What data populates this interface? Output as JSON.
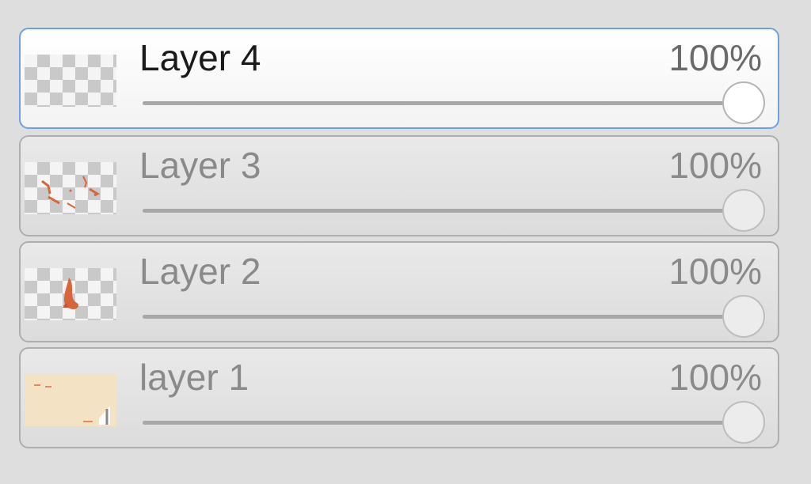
{
  "layers": [
    {
      "name": "Layer 4",
      "opacity_label": "100%",
      "opacity": 1.0,
      "active": true,
      "thumbnail_icon": "transparent-checker-thumbnail"
    },
    {
      "name": "Layer 3",
      "opacity_label": "100%",
      "opacity": 1.0,
      "active": false,
      "thumbnail_icon": "orange-strokes-thumbnail"
    },
    {
      "name": "Layer 2",
      "opacity_label": "100%",
      "opacity": 1.0,
      "active": false,
      "thumbnail_icon": "orange-figure-thumbnail"
    },
    {
      "name": "layer 1",
      "opacity_label": "100%",
      "opacity": 1.0,
      "active": false,
      "thumbnail_icon": "beige-background-thumbnail"
    }
  ],
  "colors": {
    "active_border": "#6f9fe9",
    "paint_orange": "#d9653a",
    "background_beige": "#f4e2c4"
  }
}
